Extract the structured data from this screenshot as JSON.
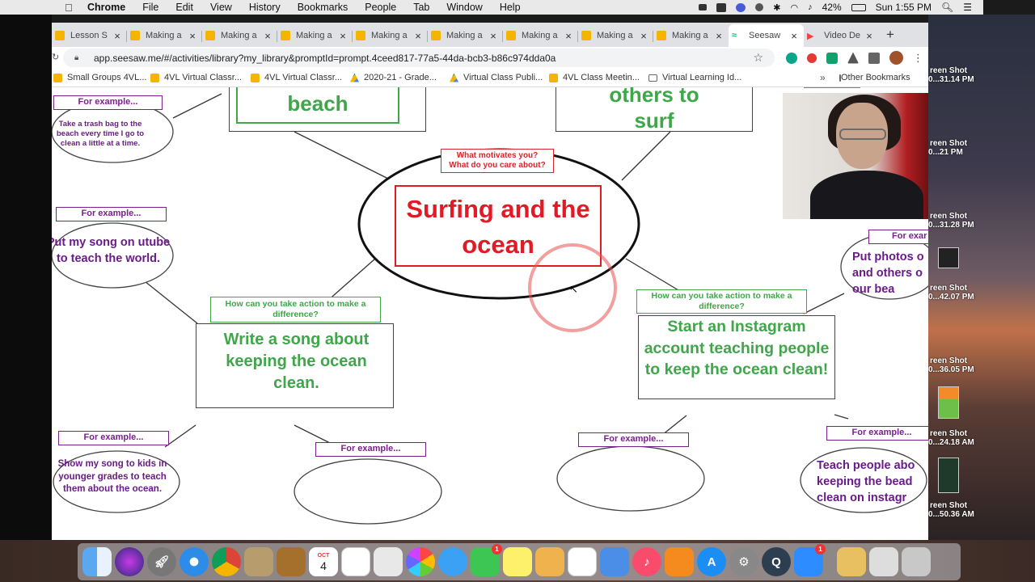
{
  "menubar": {
    "app": "Chrome",
    "items": [
      "File",
      "Edit",
      "View",
      "History",
      "Bookmarks",
      "People",
      "Tab",
      "Window",
      "Help"
    ],
    "battery": "42%",
    "clock": "Sun 1:55 PM"
  },
  "tabs": [
    {
      "label": "Lesson S",
      "icon": "slides-icon"
    },
    {
      "label": "Making a",
      "icon": "slides-icon"
    },
    {
      "label": "Making a",
      "icon": "slides-icon"
    },
    {
      "label": "Making a",
      "icon": "slides-icon"
    },
    {
      "label": "Making a",
      "icon": "slides-icon"
    },
    {
      "label": "Making a",
      "icon": "slides-icon"
    },
    {
      "label": "Making a",
      "icon": "slides-icon"
    },
    {
      "label": "Making a",
      "icon": "slides-icon"
    },
    {
      "label": "Making a",
      "icon": "slides-icon"
    },
    {
      "label": "Seesaw",
      "icon": "seesaw-icon",
      "active": true
    },
    {
      "label": "Video De",
      "icon": "video-icon"
    }
  ],
  "url": "app.seesaw.me/#/activities/library?my_library&promptId=prompt.4ceed817-77a5-44da-bcb3-b86c974dda0a",
  "bookmarks": [
    {
      "label": "Small Groups 4VL...",
      "icon": "slides-icon"
    },
    {
      "label": "4VL Virtual Classr...",
      "icon": "slides-icon"
    },
    {
      "label": "4VL Virtual Classr...",
      "icon": "slides-icon"
    },
    {
      "label": "2020-21 - Grade...",
      "icon": "drive-icon"
    },
    {
      "label": "Virtual Class Publi...",
      "icon": "drive-icon"
    },
    {
      "label": "4VL Class Meetin...",
      "icon": "slides-icon"
    },
    {
      "label": "Virtual Learning Id...",
      "icon": "folder-icon"
    }
  ],
  "bookmarks_more": "»",
  "bookmarks_other": "Other Bookmarks",
  "mindmap": {
    "center_question": "What motivates you?\nWhat do you care about?",
    "center_title": "Surfing and the ocean",
    "top_left_box": "beach",
    "top_right_box": "others to surf",
    "action_label": "How can you take action to make a difference?",
    "action_left": "Write a song about keeping the ocean clean.",
    "action_right": "Start an Instagram account teaching people to keep the ocean clean!",
    "example_label": "For example...",
    "example_top_left": "Take a trash bag to the beach every time I go to clean a little at a time.",
    "example_mid_left": "Put my song on utube to teach the world.",
    "example_mid_right": "Put photos o and others o our bea",
    "example_right_partial_label": "For exar",
    "example_bottom_left": "Show my song to kids in younger grades to teach them about the ocean.",
    "example_bottom_right": "Teach people abo keeping the bead clean on instagr"
  },
  "desktop_items": [
    {
      "l1": "reen Shot",
      "l2": "0...31.14 PM"
    },
    {
      "l1": "reen Shot",
      "l2": "0...21 PM"
    },
    {
      "l1": "reen Shot",
      "l2": "0...31.28 PM"
    },
    {
      "l1": "reen Shot",
      "l2": "0...42.07 PM"
    },
    {
      "l1": "reen Shot",
      "l2": "0...36.05 PM"
    },
    {
      "l1": "reen Shot",
      "l2": "0...24.18 AM"
    },
    {
      "l1": "reen Shot",
      "l2": "0...50.36 AM"
    }
  ],
  "dock": {
    "calendar_month": "OCT",
    "calendar_day": "4",
    "facetime_badge": "1",
    "zoom_badge": "1"
  }
}
